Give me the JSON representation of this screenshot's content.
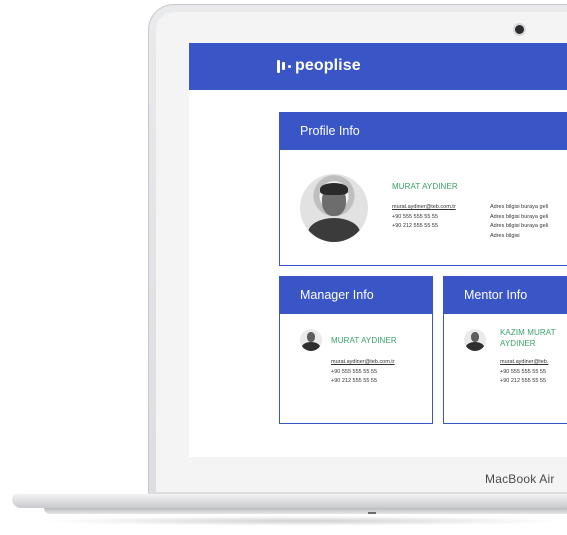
{
  "device": {
    "label": "MacBook Air"
  },
  "app": {
    "brand": "peoplise"
  },
  "profile": {
    "title": "Profile Info",
    "name": "MURAT AYDINER",
    "email": "murat.aydiner@teb.com.tr",
    "phone1": "+90 555 555 55 55",
    "phone2": "+90 212 555 55 55",
    "address": [
      "Adres bilgisi buraya geli",
      "Adres bilgisi buraya geli",
      "Adres bilgisi buraya geli",
      "Adres bilgisi"
    ]
  },
  "manager": {
    "title": "Manager Info",
    "name": "MURAT AYDINER",
    "email": "murat.aydiner@teb.com.tr",
    "phone1": "+90 555 555 55 55",
    "phone2": "+90 212 555 55 55"
  },
  "mentor": {
    "title": "Mentor Info",
    "name_line1": "KAZIM MURAT",
    "name_line2": "AYDINER",
    "email": "murat.aydiner@teb.",
    "phone1": "+90 555 555 55 55",
    "phone2": "+90 212 555 55 55"
  },
  "colors": {
    "brand": "#3a55c6",
    "name": "#3aa16a"
  }
}
